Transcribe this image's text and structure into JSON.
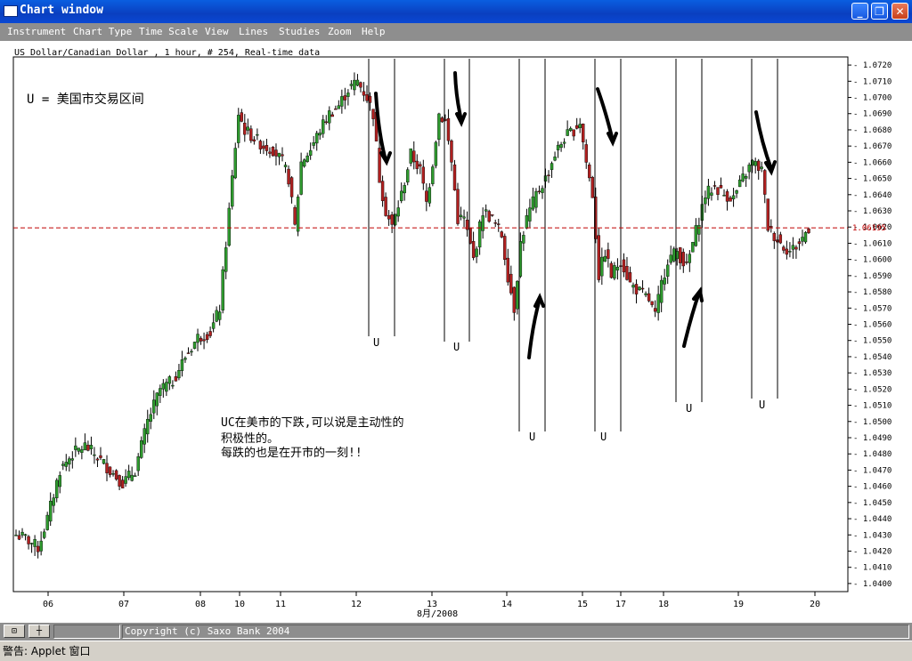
{
  "window": {
    "title": "Chart window",
    "minimize": "_",
    "maximize": "❐",
    "close": "✕"
  },
  "menu": [
    "Instrument",
    "Chart Type",
    "Time Scale",
    "View",
    "Lines",
    "Studies",
    "Zoom",
    "Help"
  ],
  "chart_header": "US Dollar/Canadian Dollar , 1 hour, # 254, Real-time data",
  "current_price": "1.06195",
  "month_label": "8月/2008",
  "status": {
    "copyright": "Copyright (c) Saxo Bank 2004",
    "warning": "警告: Applet 窗口"
  },
  "annotations": {
    "legend": "U = 美国市交易区间",
    "note_lines": [
      "UC在美市的下跌,可以说是主动性的",
      "积极性的。",
      "每跌的也是在开市的一刻!!"
    ],
    "session_marker": "U"
  },
  "colors": {
    "up": "#2e9a2e",
    "down": "#b02020",
    "price_line": "#c00000",
    "axis": "#000000"
  },
  "chart_data": {
    "type": "candlestick",
    "instrument": "US Dollar/Canadian Dollar",
    "timeframe": "1 hour",
    "x_ticks": [
      "06",
      "07",
      "08",
      "10",
      "11",
      "12",
      "13",
      "14",
      "15",
      "17",
      "18",
      "19",
      "20"
    ],
    "y_ticks": [
      "1.0400",
      "1.0410",
      "1.0420",
      "1.0430",
      "1.0440",
      "1.0450",
      "1.0460",
      "1.0470",
      "1.0480",
      "1.0490",
      "1.0500",
      "1.0510",
      "1.0520",
      "1.0530",
      "1.0540",
      "1.0550",
      "1.0560",
      "1.0570",
      "1.0580",
      "1.0590",
      "1.0600",
      "1.0610",
      "1.0620",
      "1.0630",
      "1.0640",
      "1.0650",
      "1.0660",
      "1.0670",
      "1.0680",
      "1.0690",
      "1.0700",
      "1.0710",
      "1.0720"
    ],
    "ylim": [
      1.04,
      1.072
    ],
    "current_price": 1.06195,
    "approx_close_path": [
      [
        0,
        1.043
      ],
      [
        3,
        1.0428
      ],
      [
        5,
        1.0425
      ],
      [
        7,
        1.0422
      ],
      [
        10,
        1.044
      ],
      [
        14,
        1.047
      ],
      [
        18,
        1.048
      ],
      [
        22,
        1.0485
      ],
      [
        26,
        1.0478
      ],
      [
        30,
        1.047
      ],
      [
        34,
        1.0462
      ],
      [
        38,
        1.047
      ],
      [
        42,
        1.05
      ],
      [
        46,
        1.052
      ],
      [
        50,
        1.0525
      ],
      [
        54,
        1.054
      ],
      [
        58,
        1.0552
      ],
      [
        62,
        1.0555
      ],
      [
        65,
        1.057
      ],
      [
        67,
        1.061
      ],
      [
        69,
        1.065
      ],
      [
        71,
        1.069
      ],
      [
        73,
        1.068
      ],
      [
        76,
        1.0675
      ],
      [
        79,
        1.067
      ],
      [
        82,
        1.0668
      ],
      [
        85,
        1.066
      ],
      [
        87,
        1.065
      ],
      [
        89,
        1.062
      ],
      [
        91,
        1.066
      ],
      [
        94,
        1.0668
      ],
      [
        97,
        1.068
      ],
      [
        100,
        1.069
      ],
      [
        103,
        1.0695
      ],
      [
        106,
        1.0705
      ],
      [
        109,
        1.071
      ],
      [
        112,
        1.07
      ],
      [
        114,
        1.069
      ],
      [
        116,
        1.065
      ],
      [
        118,
        1.063
      ],
      [
        120,
        1.062
      ],
      [
        123,
        1.064
      ],
      [
        126,
        1.0665
      ],
      [
        129,
        1.0655
      ],
      [
        131,
        1.0635
      ],
      [
        133,
        1.066
      ],
      [
        135,
        1.069
      ],
      [
        137,
        1.0685
      ],
      [
        139,
        1.066
      ],
      [
        141,
        1.0625
      ],
      [
        143,
        1.0625
      ],
      [
        146,
        1.06
      ],
      [
        149,
        1.063
      ],
      [
        152,
        1.0625
      ],
      [
        155,
        1.0615
      ],
      [
        157,
        1.059
      ],
      [
        159,
        1.057
      ],
      [
        161,
        1.061
      ],
      [
        163,
        1.0625
      ],
      [
        166,
        1.064
      ],
      [
        169,
        1.065
      ],
      [
        172,
        1.0665
      ],
      [
        175,
        1.0675
      ],
      [
        178,
        1.068
      ],
      [
        180,
        1.0685
      ],
      [
        182,
        1.066
      ],
      [
        184,
        1.064
      ],
      [
        186,
        1.059
      ],
      [
        188,
        1.0605
      ],
      [
        190,
        1.059
      ],
      [
        193,
        1.06
      ],
      [
        196,
        1.0585
      ],
      [
        199,
        1.058
      ],
      [
        202,
        1.0575
      ],
      [
        204,
        1.0565
      ],
      [
        206,
        1.0585
      ],
      [
        208,
        1.06
      ],
      [
        211,
        1.0605
      ],
      [
        214,
        1.0595
      ],
      [
        216,
        1.061
      ],
      [
        218,
        1.0625
      ],
      [
        220,
        1.064
      ],
      [
        223,
        1.0645
      ],
      [
        226,
        1.064
      ],
      [
        229,
        1.0638
      ],
      [
        232,
        1.065
      ],
      [
        235,
        1.066
      ],
      [
        238,
        1.0655
      ],
      [
        240,
        1.062
      ],
      [
        242,
        1.0615
      ],
      [
        244,
        1.061
      ],
      [
        247,
        1.0605
      ],
      [
        250,
        1.061
      ],
      [
        253,
        1.062
      ]
    ]
  }
}
